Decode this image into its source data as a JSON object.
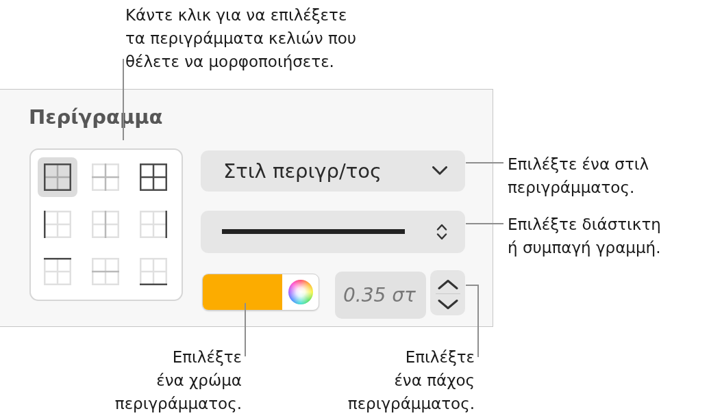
{
  "callouts": [
    {
      "lines": [
        "Κάντε κλικ για να επιλέξετε",
        "τα περιγράμματα κελιών που",
        "θέλετε να μορφοποιήσετε."
      ]
    },
    {
      "lines": [
        "Επιλέξτε ένα στιλ",
        "περιγράμματος."
      ]
    },
    {
      "lines": [
        "Επιλέξτε διάστικτη",
        "ή συμπαγή γραμμή."
      ]
    },
    {
      "lines": [
        "Επιλέξτε",
        "ένα χρώμα",
        "περιγράμματος."
      ]
    },
    {
      "lines": [
        "Επιλέξτε",
        "ένα πάχος",
        "περιγράμματος."
      ]
    }
  ],
  "panel": {
    "title": "Περίγραμμα",
    "border_options": [
      {
        "kind": "outer",
        "selected": true
      },
      {
        "kind": "inner",
        "selected": false
      },
      {
        "kind": "all",
        "selected": false
      },
      {
        "kind": "left",
        "selected": false
      },
      {
        "kind": "inner-vertical",
        "selected": false
      },
      {
        "kind": "right",
        "selected": false
      },
      {
        "kind": "top",
        "selected": false
      },
      {
        "kind": "inner-horizontal",
        "selected": false
      },
      {
        "kind": "bottom",
        "selected": false
      }
    ],
    "border_style": {
      "label": "Στιλ περιγρ/τος"
    },
    "line_style": {
      "kind": "solid"
    },
    "border_color": {
      "color": "#fcac00"
    },
    "border_width": {
      "placeholder": "0.35 στ"
    }
  }
}
